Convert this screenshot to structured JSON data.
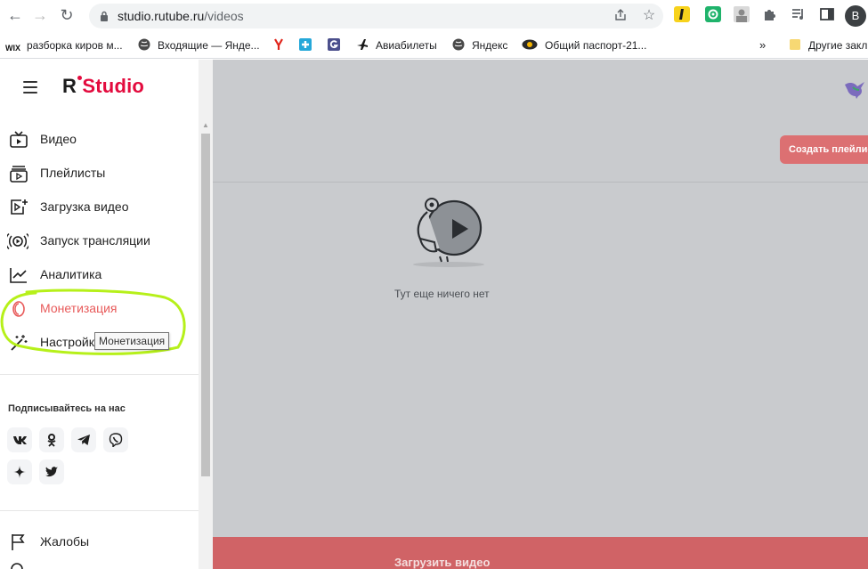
{
  "browser": {
    "url_host": "studio.rutube.ru",
    "url_path": "/videos",
    "profile_initial": "B",
    "bookmarks": [
      {
        "label": "разборка киров м...",
        "icon": "wix-icon"
      },
      {
        "label": "Входящие — Янде...",
        "icon": "globe-icon"
      },
      {
        "label": "",
        "icon": "yandex-y-icon"
      },
      {
        "label": "",
        "icon": "plus-icon"
      },
      {
        "label": "",
        "icon": "g-icon"
      },
      {
        "label": "Авиабилеты",
        "icon": "airplane-icon"
      },
      {
        "label": "Яндекс",
        "icon": "globe-icon"
      },
      {
        "label": "Общий паспорт-21...",
        "icon": "eye-icon"
      }
    ],
    "more_bookmarks": "»",
    "other_bookmarks": "Другие закл"
  },
  "sidebar": {
    "logo_r": "R",
    "logo_text": "Studio",
    "items": [
      {
        "label": "Видео",
        "icon": "tv-icon"
      },
      {
        "label": "Плейлисты",
        "icon": "playlist-icon"
      },
      {
        "label": "Загрузка видео",
        "icon": "upload-video-icon"
      },
      {
        "label": "Запуск трансляции",
        "icon": "broadcast-icon"
      },
      {
        "label": "Аналитика",
        "icon": "chart-icon"
      },
      {
        "label": "Монетизация",
        "icon": "monetization-icon"
      },
      {
        "label": "Настройки",
        "icon": "magic-wand-icon"
      }
    ],
    "tooltip": "Монетизация",
    "subscribe_title": "Подписывайтесь на нас",
    "socials": [
      "vk-icon",
      "ok-icon",
      "telegram-icon",
      "viber-icon",
      "zen-icon",
      "twitter-icon"
    ],
    "complaints_label": "Жалобы"
  },
  "main": {
    "create_playlist": "Создать плейлист",
    "empty_text": "Тут еще ничего нет",
    "upload_video": "Загрузить видео"
  },
  "colors": {
    "brand_red": "#e30b3e",
    "active_item": "#e85a5a",
    "highlight_annotation": "#b6f01a",
    "overlay": "#c9cbce"
  }
}
